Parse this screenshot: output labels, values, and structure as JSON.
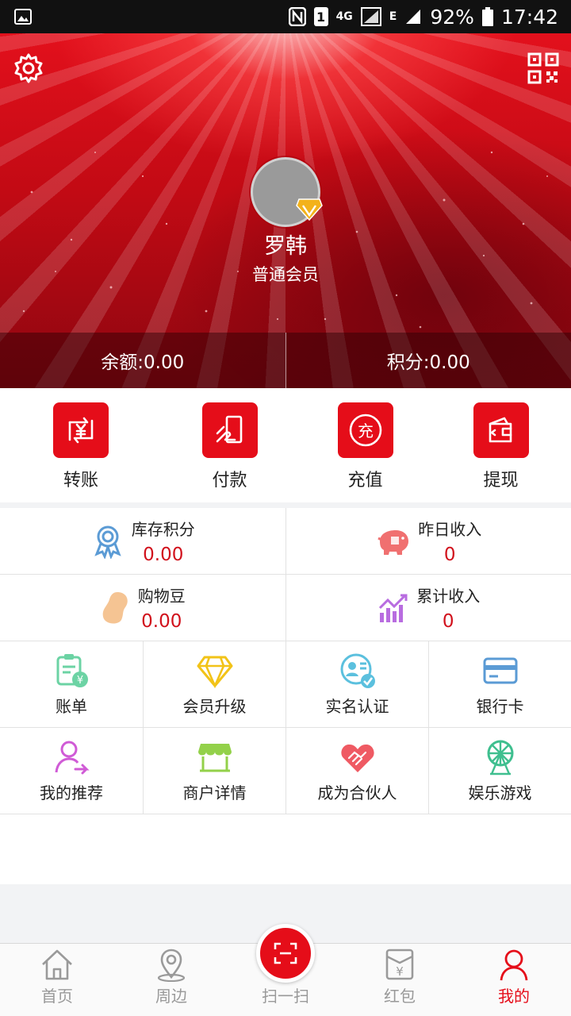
{
  "status_bar": {
    "sim_label": "1",
    "network_4g": "4G",
    "network_e": "E",
    "battery": "92%",
    "time": "17:42"
  },
  "profile": {
    "name": "罗韩",
    "level": "普通会员",
    "balance": "余额:0.00",
    "points": "积分:0.00"
  },
  "actions": [
    {
      "label": "转账",
      "icon": "transfer-icon"
    },
    {
      "label": "付款",
      "icon": "payment-icon"
    },
    {
      "label": "充值",
      "icon": "recharge-icon"
    },
    {
      "label": "提现",
      "icon": "withdraw-icon"
    }
  ],
  "kpis": [
    {
      "label": "库存积分",
      "value": "0.00",
      "icon": "medal-icon",
      "color": "#5b9bd5"
    },
    {
      "label": "昨日收入",
      "value": "0",
      "icon": "piggy-bank-icon",
      "color": "#f07070"
    },
    {
      "label": "购物豆",
      "value": "0.00",
      "icon": "bean-icon",
      "color": "#f5c493"
    },
    {
      "label": "累计收入",
      "value": "0",
      "icon": "growth-chart-icon",
      "color": "#b86ce0"
    }
  ],
  "menu": [
    {
      "label": "账单",
      "icon": "bill-icon"
    },
    {
      "label": "会员升级",
      "icon": "diamond-icon"
    },
    {
      "label": "实名认证",
      "icon": "id-verify-icon"
    },
    {
      "label": "银行卡",
      "icon": "bank-card-icon"
    },
    {
      "label": "我的推荐",
      "icon": "referral-icon"
    },
    {
      "label": "商户详情",
      "icon": "shop-icon"
    },
    {
      "label": "成为合伙人",
      "icon": "handshake-icon"
    },
    {
      "label": "娱乐游戏",
      "icon": "ferris-wheel-icon"
    }
  ],
  "tabs": [
    {
      "label": "首页",
      "icon": "home-icon"
    },
    {
      "label": "周边",
      "icon": "location-icon"
    },
    {
      "label": "扫一扫",
      "icon": "scan-icon"
    },
    {
      "label": "红包",
      "icon": "red-packet-icon"
    },
    {
      "label": "我的",
      "icon": "user-icon"
    }
  ],
  "colors": {
    "brand_red": "#e50d19",
    "value_red": "#d1111c"
  }
}
